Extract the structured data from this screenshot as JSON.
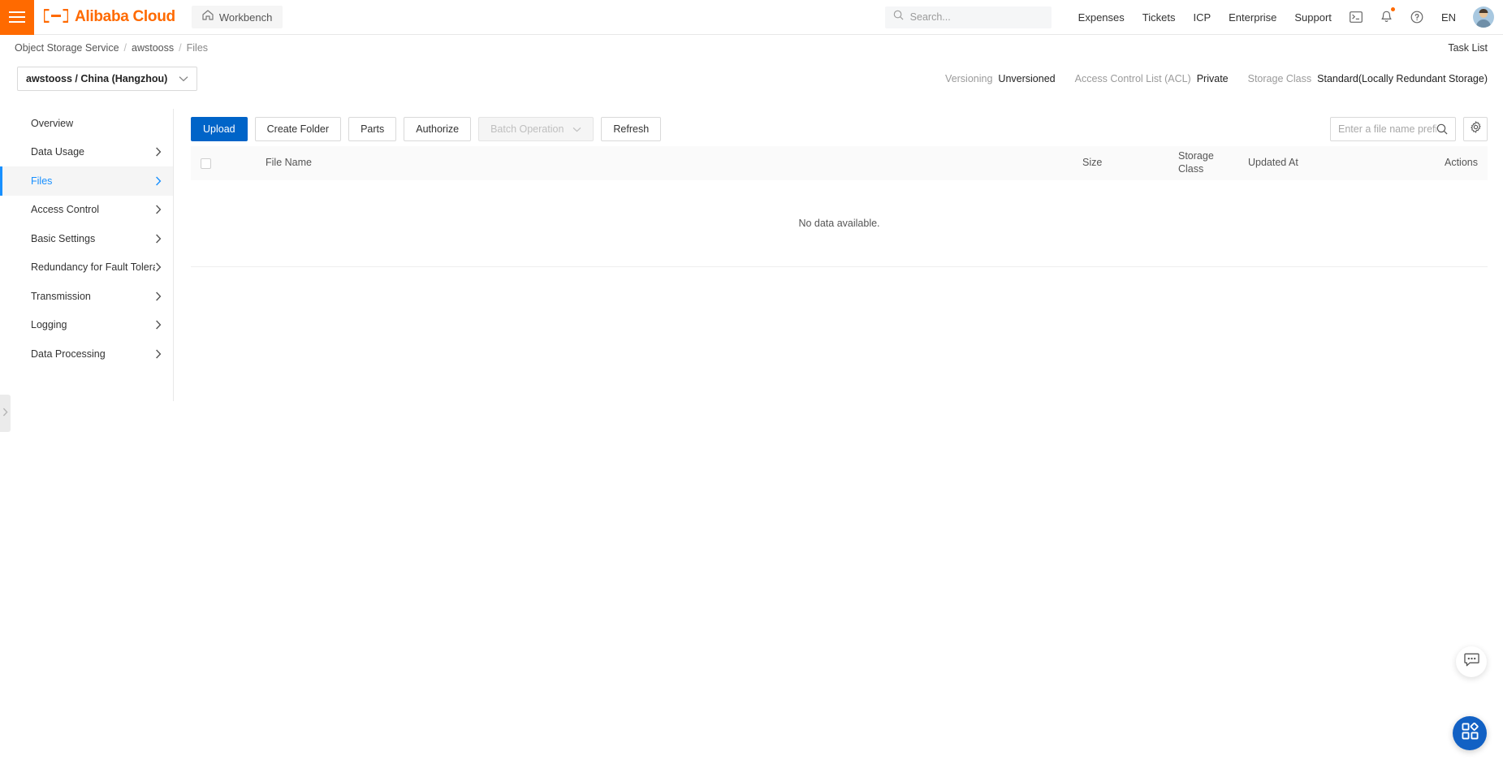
{
  "header": {
    "hamburger_icon": "hamburger-menu-icon",
    "brand_mark": "(-)",
    "brand_name": "Alibaba Cloud",
    "workbench_label": "Workbench",
    "workbench_icon": "home-icon",
    "search": {
      "placeholder": "Search...",
      "value": "",
      "icon": "search-icon"
    },
    "links": [
      {
        "label": "Expenses"
      },
      {
        "label": "Tickets"
      },
      {
        "label": "ICP"
      },
      {
        "label": "Enterprise"
      },
      {
        "label": "Support"
      }
    ],
    "icons": [
      {
        "name": "console-terminal-icon"
      },
      {
        "name": "notification-bell-icon",
        "badge": true
      },
      {
        "name": "help-question-icon"
      }
    ],
    "language": "EN",
    "avatar": "user-avatar"
  },
  "breadcrumb": {
    "items": [
      {
        "label": "Object Storage Service"
      },
      {
        "label": "awstooss"
      },
      {
        "label": "Files"
      }
    ],
    "separator": "/",
    "task_list_label": "Task List"
  },
  "bucket": {
    "selector_label": "awstooss / China (Hangzhou)",
    "chevron_icon": "chevron-down-icon",
    "meta": [
      {
        "key": "Versioning",
        "value": "Unversioned"
      },
      {
        "key": "Access Control List (ACL)",
        "value": "Private"
      },
      {
        "key": "Storage Class",
        "value": "Standard(Locally Redundant Storage)"
      }
    ]
  },
  "sidebar": {
    "items": [
      {
        "label": "Overview",
        "has_arrow": false,
        "active": false
      },
      {
        "label": "Data Usage",
        "has_arrow": true,
        "active": false
      },
      {
        "label": "Files",
        "has_arrow": true,
        "active": true
      },
      {
        "label": "Access Control",
        "has_arrow": true,
        "active": false
      },
      {
        "label": "Basic Settings",
        "has_arrow": true,
        "active": false
      },
      {
        "label": "Redundancy for Fault Tolerance",
        "has_arrow": true,
        "active": false
      },
      {
        "label": "Transmission",
        "has_arrow": true,
        "active": false
      },
      {
        "label": "Logging",
        "has_arrow": true,
        "active": false
      },
      {
        "label": "Data Processing",
        "has_arrow": true,
        "active": false
      }
    ],
    "collapse_handle_icon": "chevron-right-icon"
  },
  "toolbar": {
    "upload_label": "Upload",
    "create_folder_label": "Create Folder",
    "parts_label": "Parts",
    "authorize_label": "Authorize",
    "batch_operation_label": "Batch Operation",
    "refresh_label": "Refresh",
    "search": {
      "placeholder": "Enter a file name prefix",
      "value": "",
      "icon": "search-icon"
    },
    "settings_icon": "gear-icon"
  },
  "table": {
    "columns": [
      {
        "label": "File Name"
      },
      {
        "label": "Size"
      },
      {
        "label": "Storage Class"
      },
      {
        "label": "Updated At"
      },
      {
        "label": "Actions"
      }
    ],
    "rows": [],
    "empty_message": "No data available.",
    "select_all_checkbox": "unchecked"
  },
  "floating": {
    "chat_icon": "chat-bubble-icon",
    "apps_icon": "apps-grid-icon"
  },
  "colors": {
    "brand_orange": "#ff6a00",
    "primary_blue": "#0064c8",
    "accent_blue": "#1890ff",
    "fab_blue": "#1261c4"
  }
}
